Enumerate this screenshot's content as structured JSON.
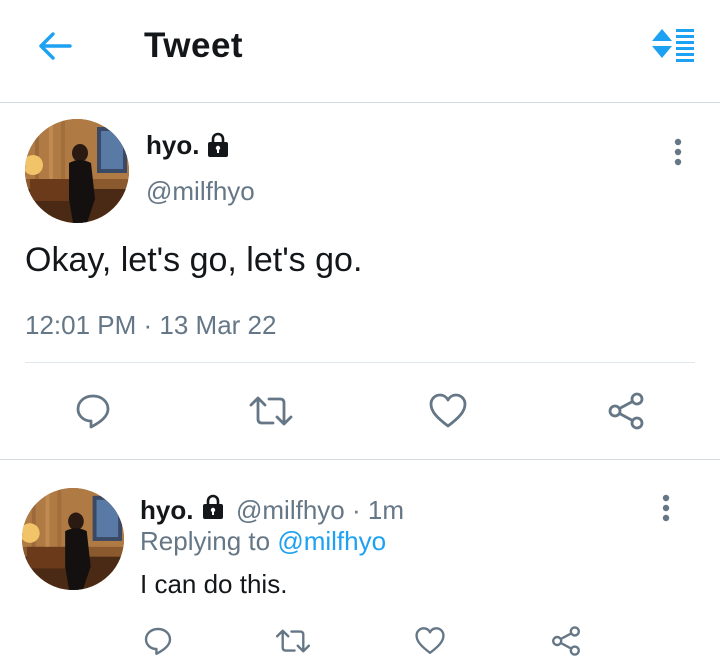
{
  "header": {
    "title": "Tweet",
    "back_icon": "arrow-left-icon",
    "sort_icon": "sort-list-icon",
    "accent": "#1da1f2"
  },
  "main_tweet": {
    "display_name": "hyo.",
    "protected_icon": "lock-icon",
    "handle": "@milfhyo",
    "text": "Okay, let's go, let's go.",
    "timestamp": "12:01 PM · 13 Mar 22",
    "actions": [
      "reply-icon",
      "retweet-icon",
      "like-icon",
      "share-icon"
    ]
  },
  "reply": {
    "display_name": "hyo.",
    "handle_time": "@milfhyo · 1m",
    "replying_prefix": "Replying to",
    "replying_handle": "@milfhyo",
    "text": "I can do this.",
    "actions": [
      "reply-icon",
      "retweet-icon",
      "like-icon",
      "share-icon"
    ]
  }
}
